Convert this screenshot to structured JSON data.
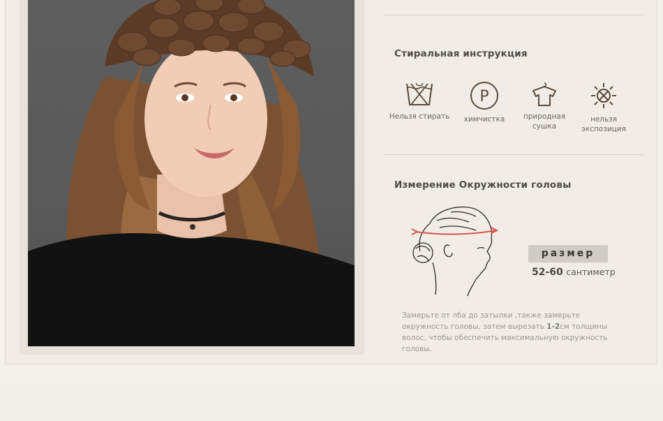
{
  "care": {
    "title": "Стиральная инструкция",
    "items": [
      {
        "icon": "no-wash-icon",
        "label": "Нельзя стирать"
      },
      {
        "icon": "dry-clean-icon",
        "label": "химчистка"
      },
      {
        "icon": "natural-dry-icon",
        "label": "природная\nсушка"
      },
      {
        "icon": "no-sun-icon",
        "label": "нельзя\nэкспозиция"
      }
    ]
  },
  "measure": {
    "title": "Измерение Окружности головы",
    "size_label": "размер",
    "size_value": "52-60",
    "size_unit": "сантиметр",
    "note_before": "Замерьте от лба до затылки ,также замерьте окружность головы, затем вырезать ",
    "note_bold": "1-2",
    "note_after": "см толщины волос, чтобы обеспечить максимальную окружность головы."
  },
  "colors": {
    "accent": "#d9534f",
    "icon": "#5a4a3a",
    "panel_bg": "#f1ede6"
  }
}
